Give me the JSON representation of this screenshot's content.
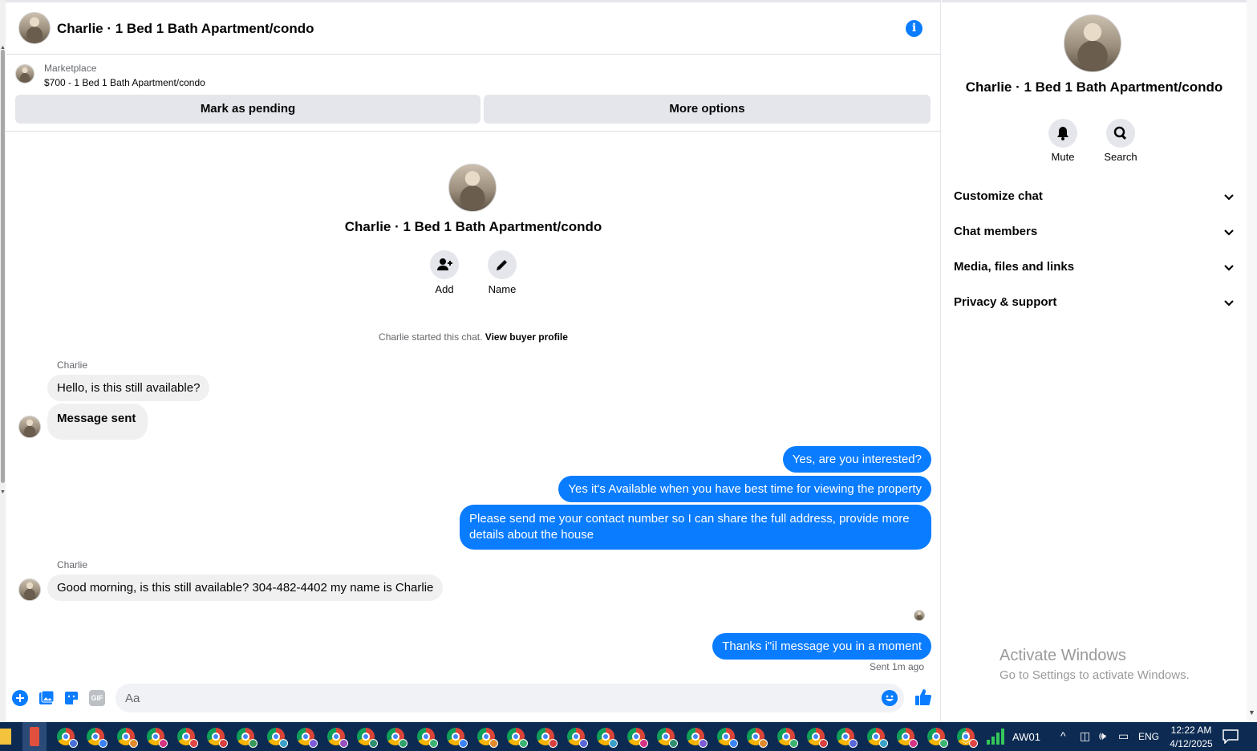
{
  "header": {
    "title": "Charlie · 1 Bed 1 Bath Apartment/condo"
  },
  "marketplace": {
    "label": "Marketplace",
    "listing": "$700 - 1 Bed 1 Bath Apartment/condo",
    "pending_label": "Mark as pending",
    "more_label": "More options"
  },
  "intro": {
    "title": "Charlie · 1 Bed 1 Bath Apartment/condo",
    "add_label": "Add",
    "name_label": "Name",
    "started_text": "Charlie started this chat.",
    "buyer_link": "View buyer profile"
  },
  "messages": [
    {
      "sender": "Charlie"
    },
    {
      "text": "Hello, is this still available?"
    },
    {
      "text": "Message sent"
    },
    {
      "text": "Yes, are you interested?"
    },
    {
      "text": "Yes it's Available when you have best time for viewing the property"
    },
    {
      "text": "Please send me your contact number so I can share the full address, provide more details about the house"
    },
    {
      "sender": "Charlie"
    },
    {
      "text": "Good morning, is this still available? 304-482-4402 my name is Charlie"
    },
    {
      "text": "Thanks i\"il message you in a moment"
    }
  ],
  "status": {
    "sent": "Sent 1m ago"
  },
  "composer": {
    "placeholder": "Aa",
    "gif_label": "GIF"
  },
  "panel": {
    "title": "Charlie · 1 Bed 1 Bath Apartment/condo",
    "mute_label": "Mute",
    "search_label": "Search",
    "sections": [
      "Customize chat",
      "Chat members",
      "Media, files and links",
      "Privacy & support"
    ]
  },
  "watermark": {
    "line1": "Activate Windows",
    "line2": "Go to Settings to activate Windows."
  },
  "taskbar": {
    "network_name": "AW01",
    "language": "ENG",
    "time": "12:22 AM",
    "date": "4/12/2025",
    "chrome_profile_badges": [
      "#4a6fd8",
      "#3b82f6",
      "#e08a2e",
      "#d63384",
      "#e04545",
      "#d94040",
      "#3a9a5a",
      "#3aa0c8",
      "#7d5bd8",
      "#9a4fc0",
      "#2f8f6f",
      "#2fa36b",
      "#3cb371",
      "#3b82f6",
      "#e08a2e",
      "#3cb371",
      "#d94040",
      "#5a67d8",
      "#3aa0c8",
      "#d63384",
      "#2f8f6f",
      "#7d5bd8",
      "#3b82f6",
      "#e08a2e",
      "#3cb371",
      "#d94040",
      "#5a67d8",
      "#3aa0c8",
      "#d63384",
      "#3cb371",
      "#e04545"
    ],
    "colors": {
      "background": "#0d2b52",
      "accent": "#0a7cff"
    }
  }
}
